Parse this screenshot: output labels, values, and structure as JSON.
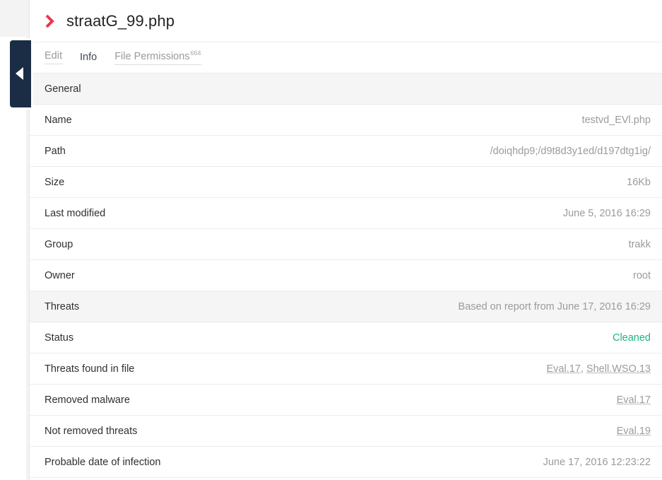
{
  "window": {
    "title": "straatG_99.php",
    "expand_icon": "chevron-right-icon",
    "collapse_handle_icon": "chevron-left-icon"
  },
  "colors": {
    "accent": "#e8384f",
    "status_ok": "#15b881",
    "handle_bg": "#1b2d44",
    "section_bg": "#f5f5f5",
    "muted_text": "#9b9b9b"
  },
  "tabs": [
    {
      "label": "Edit",
      "active": false,
      "superscript": ""
    },
    {
      "label": "Info",
      "active": true,
      "superscript": ""
    },
    {
      "label": "File Permissions",
      "active": false,
      "superscript": "664"
    }
  ],
  "sections": [
    {
      "title": "General",
      "note": "",
      "rows": [
        {
          "label": "Name",
          "value": "testvd_EVl.php",
          "kind": "text"
        },
        {
          "label": "Path",
          "value": "/doiqhdp9;/d9t8d3y1ed/d197dtg1ig/",
          "kind": "text"
        },
        {
          "label": "Size",
          "value": "16Kb",
          "kind": "text"
        },
        {
          "label": "Last modified",
          "value": "June 5, 2016 16:29",
          "kind": "text"
        },
        {
          "label": "Group",
          "value": "trakk",
          "kind": "text"
        },
        {
          "label": "Owner",
          "value": "root",
          "kind": "text"
        }
      ]
    },
    {
      "title": "Threats",
      "note": "Based on report from June 17, 2016 16:29",
      "rows": [
        {
          "label": "Status",
          "value": "Cleaned",
          "kind": "status-ok"
        },
        {
          "label": "Threats found in file",
          "value": "Eval.17, Shell.WSO.13",
          "kind": "links",
          "links": [
            "Eval.17",
            "Shell.WSO.13"
          ]
        },
        {
          "label": "Removed malware",
          "value": "Eval.17",
          "kind": "links",
          "links": [
            "Eval.17"
          ]
        },
        {
          "label": "Not removed threats",
          "value": "Eval.19",
          "kind": "links",
          "links": [
            "Eval.19"
          ]
        },
        {
          "label": "Probable date of infection",
          "value": "June 17, 2016 12:23:22",
          "kind": "text"
        }
      ]
    }
  ]
}
